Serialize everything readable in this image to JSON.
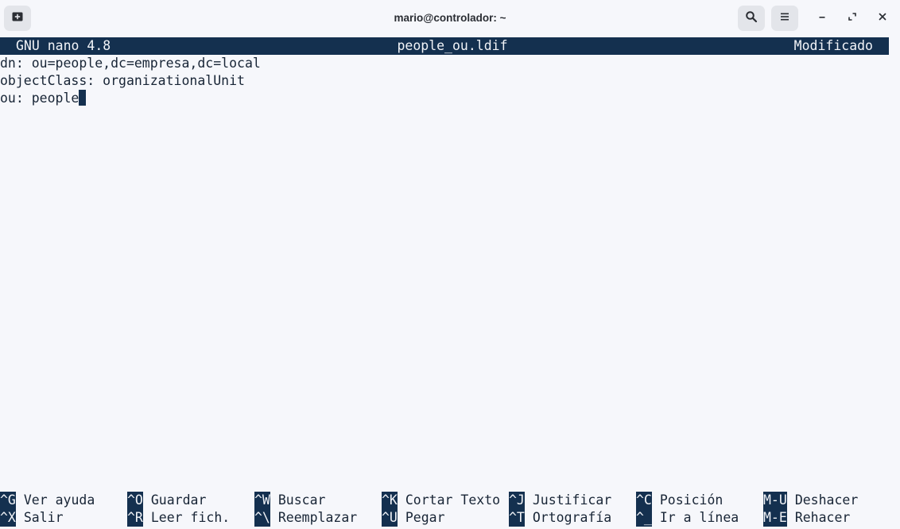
{
  "window": {
    "title": "mario@controlador: ~"
  },
  "icons": {
    "new_tab": "new-tab-icon",
    "search": "search-icon",
    "menu": "hamburger-menu-icon",
    "minimize": "minimize-icon",
    "maximize": "maximize-icon",
    "close": "close-icon"
  },
  "colors": {
    "terminal_bg": "#f6f7fb",
    "terminal_fg": "#182536",
    "nano_bar_bg": "#14304f",
    "nano_bar_fg": "#f2f4f8"
  },
  "nano": {
    "version": "GNU nano 4.8",
    "filename": "people_ou.ldif",
    "status": "Modificado"
  },
  "editor": {
    "lines": [
      "dn: ou=people,dc=empresa,dc=local",
      "objectClass: organizationalUnit",
      "ou: people"
    ]
  },
  "shortcuts": {
    "row1": [
      {
        "key": "^G",
        "label": "Ver ayuda"
      },
      {
        "key": "^O",
        "label": "Guardar"
      },
      {
        "key": "^W",
        "label": "Buscar"
      },
      {
        "key": "^K",
        "label": "Cortar Texto"
      },
      {
        "key": "^J",
        "label": "Justificar"
      },
      {
        "key": "^C",
        "label": "Posición"
      },
      {
        "key": "M-U",
        "label": "Deshacer"
      }
    ],
    "row2": [
      {
        "key": "^X",
        "label": "Salir"
      },
      {
        "key": "^R",
        "label": "Leer fich."
      },
      {
        "key": "^\\",
        "label": "Reemplazar"
      },
      {
        "key": "^U",
        "label": "Pegar"
      },
      {
        "key": "^T",
        "label": "Ortografía"
      },
      {
        "key": "^_",
        "label": "Ir a línea"
      },
      {
        "key": "M-E",
        "label": "Rehacer"
      }
    ]
  }
}
